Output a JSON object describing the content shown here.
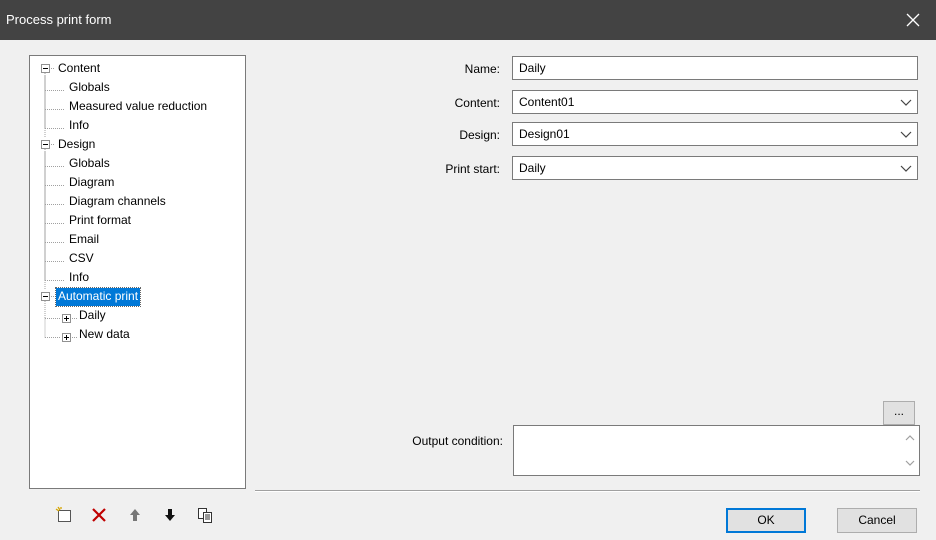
{
  "window": {
    "title": "Process print form"
  },
  "tree": {
    "nodes": [
      {
        "label": "Content",
        "expanded": true
      },
      {
        "label": "Globals"
      },
      {
        "label": "Measured value reduction"
      },
      {
        "label": "Info"
      },
      {
        "label": "Design",
        "expanded": true
      },
      {
        "label": "Globals"
      },
      {
        "label": "Diagram"
      },
      {
        "label": "Diagram channels"
      },
      {
        "label": "Print format"
      },
      {
        "label": "Email"
      },
      {
        "label": "CSV"
      },
      {
        "label": "Info"
      },
      {
        "label": "Automatic print",
        "expanded": true,
        "selected": true
      },
      {
        "label": "Daily",
        "expanded": false
      },
      {
        "label": "New data",
        "expanded": false
      }
    ]
  },
  "form": {
    "name_label": "Name:",
    "name_value": "Daily",
    "content_label": "Content:",
    "content_value": "Content01",
    "design_label": "Design:",
    "design_value": "Design01",
    "print_start_label": "Print start:",
    "print_start_value": "Daily",
    "output_condition_label": "Output condition:",
    "output_condition_value": "",
    "browse_label": "..."
  },
  "toolbar": {
    "icons": [
      "new-item-icon",
      "delete-icon",
      "move-up-icon",
      "move-down-icon",
      "copy-icon"
    ]
  },
  "buttons": {
    "ok": "OK",
    "cancel": "Cancel"
  },
  "colors": {
    "titlebar": "#434343",
    "selection": "#0078d7",
    "delete": "#c00000"
  }
}
